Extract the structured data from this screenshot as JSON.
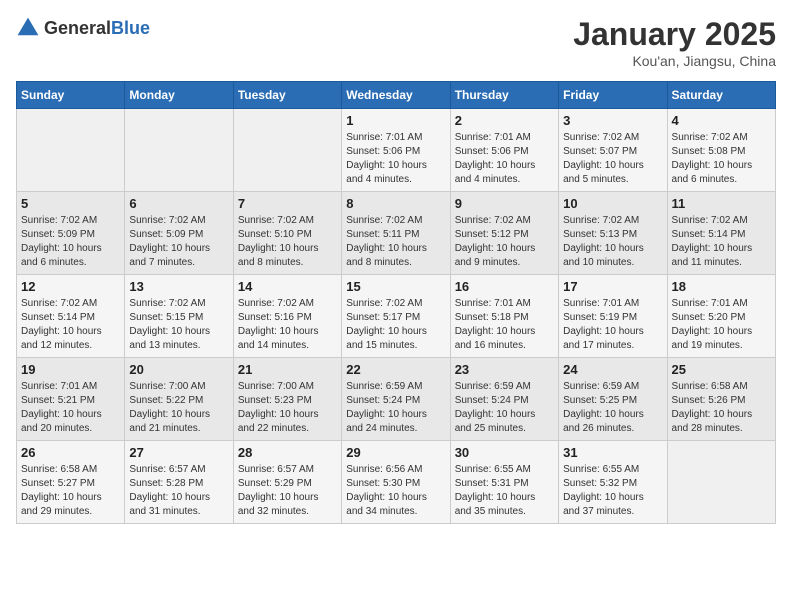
{
  "header": {
    "logo_general": "General",
    "logo_blue": "Blue",
    "month_title": "January 2025",
    "location": "Kou'an, Jiangsu, China"
  },
  "weekdays": [
    "Sunday",
    "Monday",
    "Tuesday",
    "Wednesday",
    "Thursday",
    "Friday",
    "Saturday"
  ],
  "rows": [
    [
      {
        "day": "",
        "info": ""
      },
      {
        "day": "",
        "info": ""
      },
      {
        "day": "",
        "info": ""
      },
      {
        "day": "1",
        "info": "Sunrise: 7:01 AM\nSunset: 5:06 PM\nDaylight: 10 hours\nand 4 minutes."
      },
      {
        "day": "2",
        "info": "Sunrise: 7:01 AM\nSunset: 5:06 PM\nDaylight: 10 hours\nand 4 minutes."
      },
      {
        "day": "3",
        "info": "Sunrise: 7:02 AM\nSunset: 5:07 PM\nDaylight: 10 hours\nand 5 minutes."
      },
      {
        "day": "4",
        "info": "Sunrise: 7:02 AM\nSunset: 5:08 PM\nDaylight: 10 hours\nand 6 minutes."
      }
    ],
    [
      {
        "day": "5",
        "info": "Sunrise: 7:02 AM\nSunset: 5:09 PM\nDaylight: 10 hours\nand 6 minutes."
      },
      {
        "day": "6",
        "info": "Sunrise: 7:02 AM\nSunset: 5:09 PM\nDaylight: 10 hours\nand 7 minutes."
      },
      {
        "day": "7",
        "info": "Sunrise: 7:02 AM\nSunset: 5:10 PM\nDaylight: 10 hours\nand 8 minutes."
      },
      {
        "day": "8",
        "info": "Sunrise: 7:02 AM\nSunset: 5:11 PM\nDaylight: 10 hours\nand 8 minutes."
      },
      {
        "day": "9",
        "info": "Sunrise: 7:02 AM\nSunset: 5:12 PM\nDaylight: 10 hours\nand 9 minutes."
      },
      {
        "day": "10",
        "info": "Sunrise: 7:02 AM\nSunset: 5:13 PM\nDaylight: 10 hours\nand 10 minutes."
      },
      {
        "day": "11",
        "info": "Sunrise: 7:02 AM\nSunset: 5:14 PM\nDaylight: 10 hours\nand 11 minutes."
      }
    ],
    [
      {
        "day": "12",
        "info": "Sunrise: 7:02 AM\nSunset: 5:14 PM\nDaylight: 10 hours\nand 12 minutes."
      },
      {
        "day": "13",
        "info": "Sunrise: 7:02 AM\nSunset: 5:15 PM\nDaylight: 10 hours\nand 13 minutes."
      },
      {
        "day": "14",
        "info": "Sunrise: 7:02 AM\nSunset: 5:16 PM\nDaylight: 10 hours\nand 14 minutes."
      },
      {
        "day": "15",
        "info": "Sunrise: 7:02 AM\nSunset: 5:17 PM\nDaylight: 10 hours\nand 15 minutes."
      },
      {
        "day": "16",
        "info": "Sunrise: 7:01 AM\nSunset: 5:18 PM\nDaylight: 10 hours\nand 16 minutes."
      },
      {
        "day": "17",
        "info": "Sunrise: 7:01 AM\nSunset: 5:19 PM\nDaylight: 10 hours\nand 17 minutes."
      },
      {
        "day": "18",
        "info": "Sunrise: 7:01 AM\nSunset: 5:20 PM\nDaylight: 10 hours\nand 19 minutes."
      }
    ],
    [
      {
        "day": "19",
        "info": "Sunrise: 7:01 AM\nSunset: 5:21 PM\nDaylight: 10 hours\nand 20 minutes."
      },
      {
        "day": "20",
        "info": "Sunrise: 7:00 AM\nSunset: 5:22 PM\nDaylight: 10 hours\nand 21 minutes."
      },
      {
        "day": "21",
        "info": "Sunrise: 7:00 AM\nSunset: 5:23 PM\nDaylight: 10 hours\nand 22 minutes."
      },
      {
        "day": "22",
        "info": "Sunrise: 6:59 AM\nSunset: 5:24 PM\nDaylight: 10 hours\nand 24 minutes."
      },
      {
        "day": "23",
        "info": "Sunrise: 6:59 AM\nSunset: 5:24 PM\nDaylight: 10 hours\nand 25 minutes."
      },
      {
        "day": "24",
        "info": "Sunrise: 6:59 AM\nSunset: 5:25 PM\nDaylight: 10 hours\nand 26 minutes."
      },
      {
        "day": "25",
        "info": "Sunrise: 6:58 AM\nSunset: 5:26 PM\nDaylight: 10 hours\nand 28 minutes."
      }
    ],
    [
      {
        "day": "26",
        "info": "Sunrise: 6:58 AM\nSunset: 5:27 PM\nDaylight: 10 hours\nand 29 minutes."
      },
      {
        "day": "27",
        "info": "Sunrise: 6:57 AM\nSunset: 5:28 PM\nDaylight: 10 hours\nand 31 minutes."
      },
      {
        "day": "28",
        "info": "Sunrise: 6:57 AM\nSunset: 5:29 PM\nDaylight: 10 hours\nand 32 minutes."
      },
      {
        "day": "29",
        "info": "Sunrise: 6:56 AM\nSunset: 5:30 PM\nDaylight: 10 hours\nand 34 minutes."
      },
      {
        "day": "30",
        "info": "Sunrise: 6:55 AM\nSunset: 5:31 PM\nDaylight: 10 hours\nand 35 minutes."
      },
      {
        "day": "31",
        "info": "Sunrise: 6:55 AM\nSunset: 5:32 PM\nDaylight: 10 hours\nand 37 minutes."
      },
      {
        "day": "",
        "info": ""
      }
    ]
  ]
}
